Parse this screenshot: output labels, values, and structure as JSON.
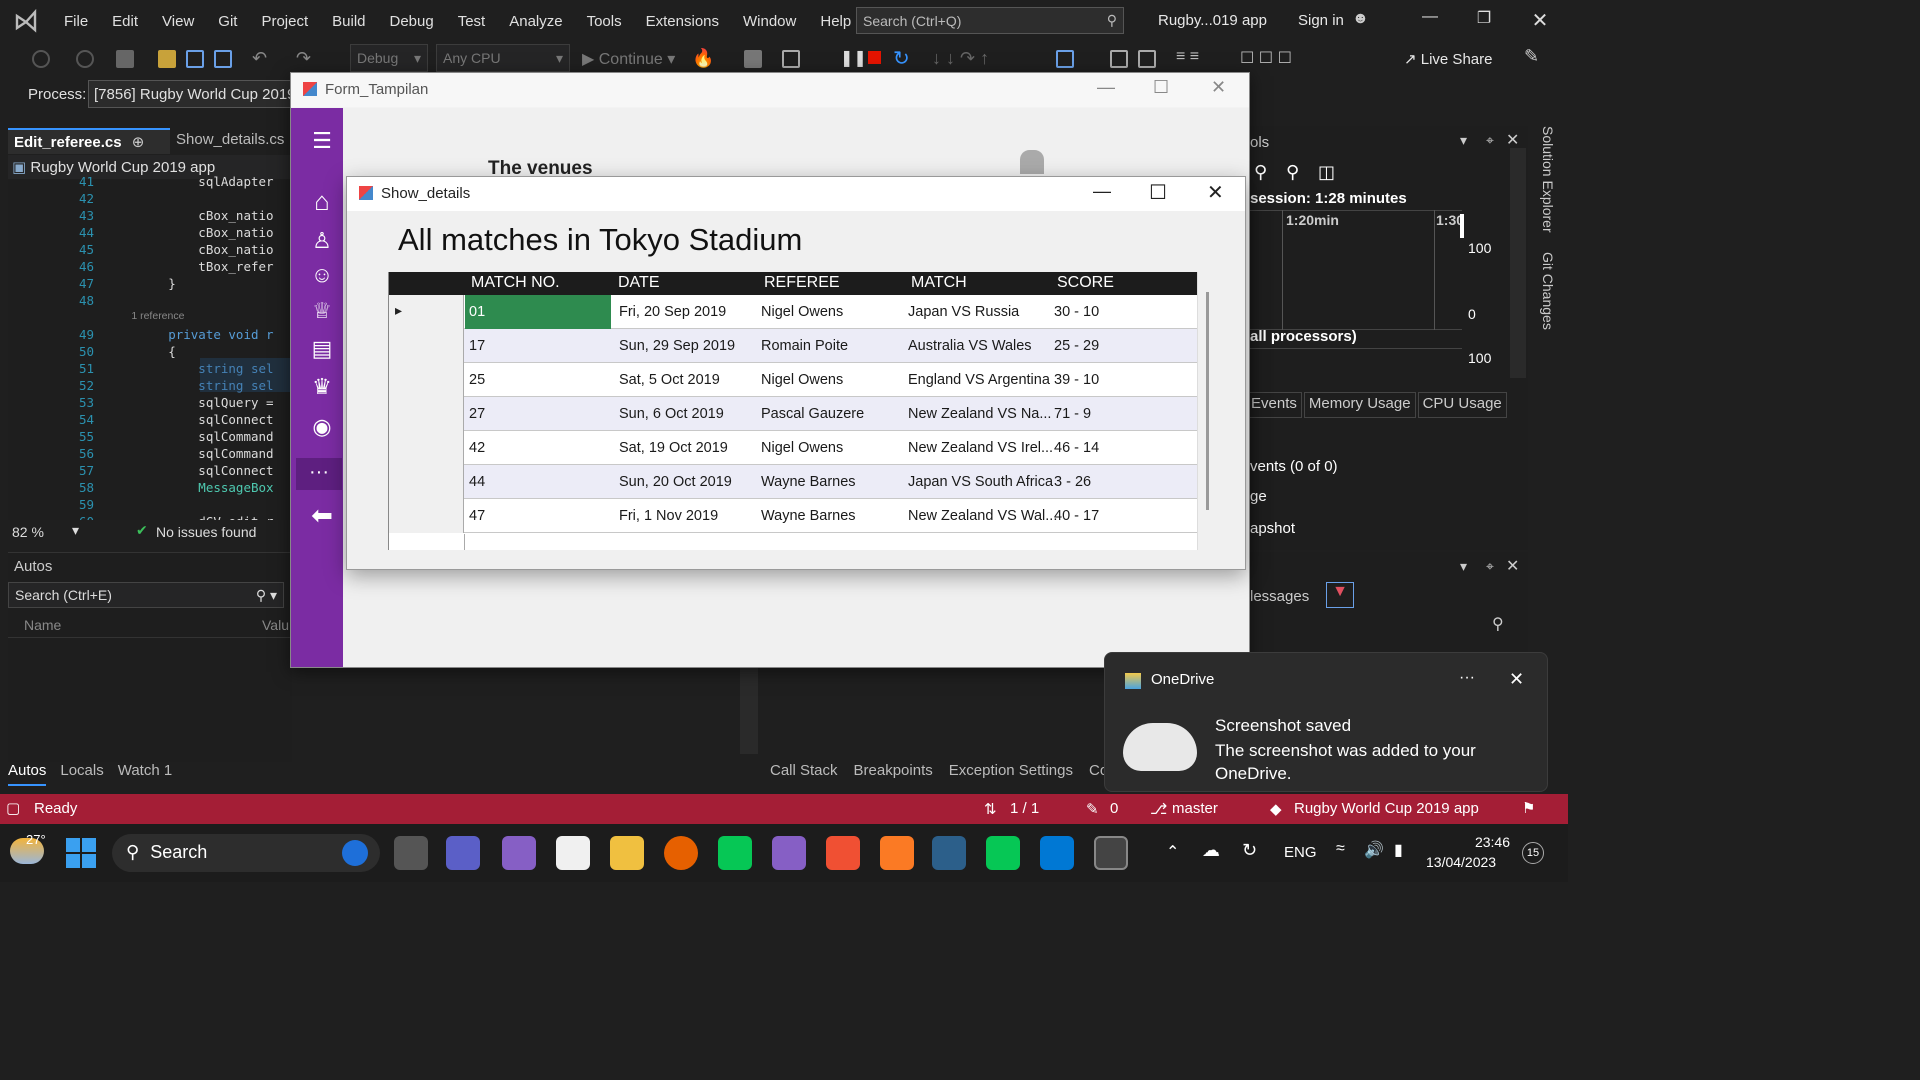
{
  "menubar": {
    "items": [
      "File",
      "Edit",
      "View",
      "Git",
      "Project",
      "Build",
      "Debug",
      "Test",
      "Analyze",
      "Tools",
      "Extensions",
      "Window",
      "Help"
    ],
    "search_placeholder": "Search (Ctrl+Q)",
    "app_title": "Rugby...019 app",
    "sign_in": "Sign in"
  },
  "toolbar": {
    "config": "Debug",
    "platform": "Any CPU",
    "continue": "Continue",
    "live_share": "Live Share",
    "process_label": "Process:",
    "process_value": "[7856] Rugby World Cup 2019"
  },
  "editor": {
    "tab_active": "Edit_referee.cs",
    "tab_pin": "⊕",
    "tab_inactive": "Show_details.cs",
    "project": "Rugby World Cup 2019 app",
    "lines": [
      {
        "n": "41",
        "code": "            sqlAdapter"
      },
      {
        "n": "42",
        "code": ""
      },
      {
        "n": "43",
        "code": "            cBox_natio"
      },
      {
        "n": "44",
        "code": "            cBox_natio"
      },
      {
        "n": "45",
        "code": "            cBox_natio"
      },
      {
        "n": "46",
        "code": "            tBox_refer"
      },
      {
        "n": "47",
        "code": "        }"
      },
      {
        "n": "48",
        "code": ""
      },
      {
        "n": "",
        "code": "        1 reference"
      },
      {
        "n": "49",
        "code": "        private void r"
      },
      {
        "n": "50",
        "code": "        {"
      },
      {
        "n": "51",
        "code": "            string sel"
      },
      {
        "n": "52",
        "code": "            string sel"
      },
      {
        "n": "53",
        "code": "            sqlQuery ="
      },
      {
        "n": "54",
        "code": "            sqlConnect"
      },
      {
        "n": "55",
        "code": "            sqlCommand"
      },
      {
        "n": "56",
        "code": "            sqlCommand"
      },
      {
        "n": "57",
        "code": "            sqlConnect"
      },
      {
        "n": "58",
        "code": "            MessageBox"
      },
      {
        "n": "59",
        "code": ""
      },
      {
        "n": "60",
        "code": "            dGV_edit_r"
      }
    ],
    "zoom": "82 %",
    "issues": "No issues found"
  },
  "autos": {
    "title": "Autos",
    "search": "Search (Ctrl+E)",
    "col_name": "Name",
    "col_value": "Valu",
    "tabs": [
      "Autos",
      "Locals",
      "Watch 1"
    ]
  },
  "debug_tools": {
    "title": "ols",
    "session": "session: 1:28 minutes",
    "tick1": "1:20min",
    "tick2": "1:30",
    "val100": "100",
    "val0": "0",
    "processors": "all processors)",
    "val100b": "100",
    "tabs": [
      "Events",
      "Memory Usage",
      "CPU Usage"
    ],
    "events": "vents (0 of 0)",
    "usage": "ge",
    "snapshot": "apshot",
    "messages": "lessages"
  },
  "callstack_tabs": [
    "Call Stack",
    "Breakpoints",
    "Exception Settings",
    "Com"
  ],
  "sidebar_vertical": [
    "Solution Explorer",
    "Git Changes"
  ],
  "statusbar": {
    "ready": "Ready",
    "lines": "1 / 1",
    "edits": "0",
    "branch": "master",
    "repo": "Rugby World Cup 2019 app"
  },
  "form_tampilan": {
    "title": "Form_Tampilan",
    "venues_heading": "The venues"
  },
  "show_details": {
    "title": "Show_details",
    "heading": "All matches in Tokyo Stadium",
    "columns": [
      "MATCH NO.",
      "DATE",
      "REFEREE",
      "MATCH",
      "SCORE"
    ],
    "rows": [
      {
        "no": "01",
        "date": "Fri, 20 Sep 2019",
        "referee": "Nigel Owens",
        "match": "Japan VS Russia",
        "score": "30 - 10"
      },
      {
        "no": "17",
        "date": "Sun, 29 Sep 2019",
        "referee": "Romain Poite",
        "match": "Australia VS Wales",
        "score": "25 - 29"
      },
      {
        "no": "25",
        "date": "Sat,  5 Oct 2019",
        "referee": "Nigel Owens",
        "match": "England VS Argentina",
        "score": "39 - 10"
      },
      {
        "no": "27",
        "date": "Sun,  6 Oct 2019",
        "referee": "Pascal Gauzere",
        "match": "New Zealand VS Na...",
        "score": "71 - 9"
      },
      {
        "no": "42",
        "date": "Sat, 19 Oct 2019",
        "referee": "Nigel Owens",
        "match": "New Zealand VS Irel...",
        "score": "46 - 14"
      },
      {
        "no": "44",
        "date": "Sun, 20 Oct 2019",
        "referee": "Wayne Barnes",
        "match": "Japan VS South Africa",
        "score": "3 - 26"
      },
      {
        "no": "47",
        "date": "Fri,  1 Nov 2019",
        "referee": "Wayne Barnes",
        "match": "New Zealand VS Wal...",
        "score": "40 - 17"
      }
    ]
  },
  "toast": {
    "app": "OneDrive",
    "more": "···",
    "title": "Screenshot saved",
    "body": "The screenshot was added to your OneDrive."
  },
  "taskbar": {
    "temperature": "27°",
    "search": "Search",
    "lang": "ENG",
    "time": "23:46",
    "date": "13/04/2023",
    "badge": "15"
  },
  "colors": {
    "accent_purple": "#7b2ca3",
    "status_red": "#a41e36",
    "selected_cell": "#2e8b4f",
    "alt_row": "#ececf7"
  }
}
